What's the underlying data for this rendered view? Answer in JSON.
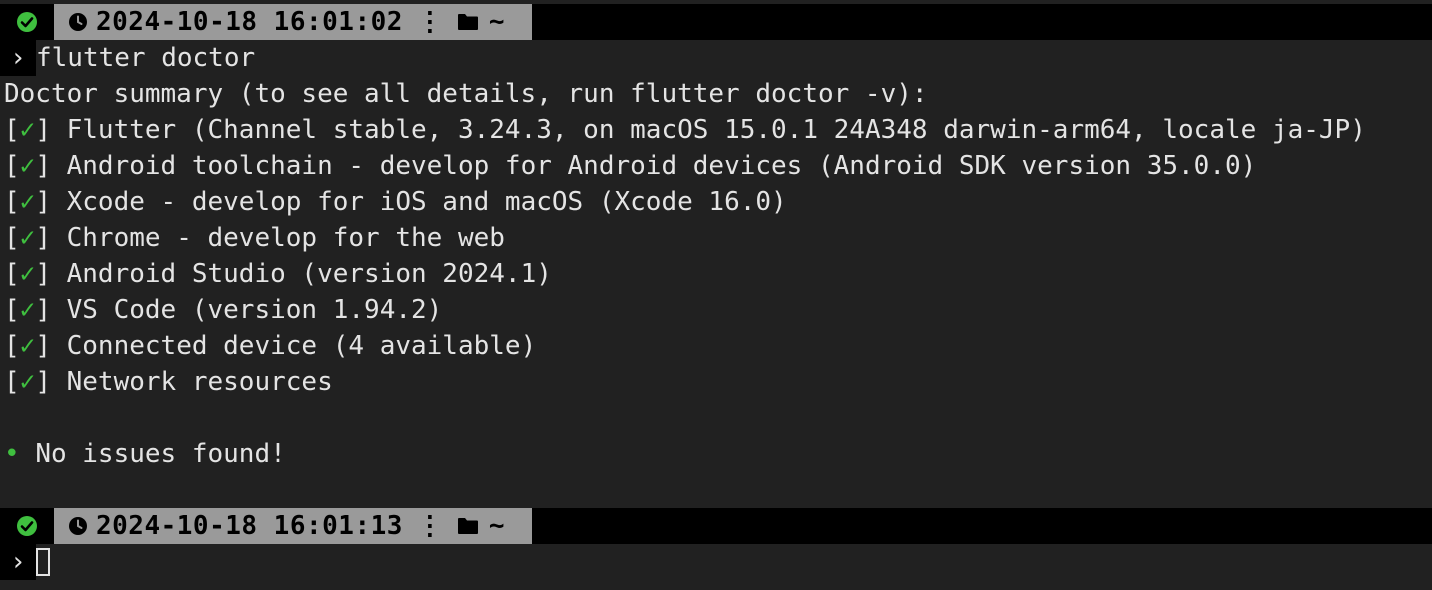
{
  "colors": {
    "background": "#212121",
    "text": "#e4e4e4",
    "success": "#3fbf3f",
    "prompt_info_bg": "#9a9a9a"
  },
  "prompt1": {
    "status_icon": "check-circle-icon",
    "clock_icon": "clock-icon",
    "timestamp": "2024-10-18 16:01:02",
    "separator": "⋮",
    "folder_icon": "folder-icon",
    "dir": "~",
    "arrow": "›"
  },
  "command": "flutter doctor",
  "summary_header": "Doctor summary (to see all details, run flutter doctor -v):",
  "checks": [
    {
      "bracket_open": "[",
      "mark": "✓",
      "bracket_close": "]",
      "text": "Flutter (Channel stable, 3.24.3, on macOS 15.0.1 24A348 darwin-arm64, locale ja-JP)"
    },
    {
      "bracket_open": "[",
      "mark": "✓",
      "bracket_close": "]",
      "text": "Android toolchain - develop for Android devices (Android SDK version 35.0.0)"
    },
    {
      "bracket_open": "[",
      "mark": "✓",
      "bracket_close": "]",
      "text": "Xcode - develop for iOS and macOS (Xcode 16.0)"
    },
    {
      "bracket_open": "[",
      "mark": "✓",
      "bracket_close": "]",
      "text": "Chrome - develop for the web"
    },
    {
      "bracket_open": "[",
      "mark": "✓",
      "bracket_close": "]",
      "text": "Android Studio (version 2024.1)"
    },
    {
      "bracket_open": "[",
      "mark": "✓",
      "bracket_close": "]",
      "text": "VS Code (version 1.94.2)"
    },
    {
      "bracket_open": "[",
      "mark": "✓",
      "bracket_close": "]",
      "text": "Connected device (4 available)"
    },
    {
      "bracket_open": "[",
      "mark": "✓",
      "bracket_close": "]",
      "text": "Network resources"
    }
  ],
  "result": {
    "bullet": "•",
    "text": "No issues found!"
  },
  "prompt2": {
    "status_icon": "check-circle-icon",
    "clock_icon": "clock-icon",
    "timestamp": "2024-10-18 16:01:13",
    "separator": "⋮",
    "folder_icon": "folder-icon",
    "dir": "~",
    "arrow": "›"
  }
}
